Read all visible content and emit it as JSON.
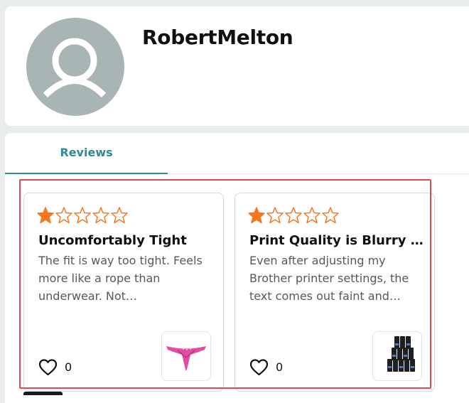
{
  "profile": {
    "name": "RobertMelton"
  },
  "tabs": [
    {
      "label": "Reviews",
      "active": true
    }
  ],
  "reviews": [
    {
      "rating": 1,
      "max_rating": 5,
      "title": "Uncomfortably Tight",
      "body": "The fit is way too tight. Feels more like a rope than underwear. Not…",
      "likes": "0",
      "product_icon": "pink-thong-underwear-image"
    },
    {
      "rating": 1,
      "max_rating": 5,
      "title": "Print Quality is Blurry a…",
      "body": "Even after adjusting my Brother printer settings, the text comes out faint and…",
      "likes": "0",
      "product_icon": "ink-cartridge-pack-image"
    }
  ],
  "colors": {
    "star": "#f8761f",
    "tab_active": "#2f8a96",
    "highlight": "#e5484d",
    "avatar_bg": "#a9b4b5"
  }
}
